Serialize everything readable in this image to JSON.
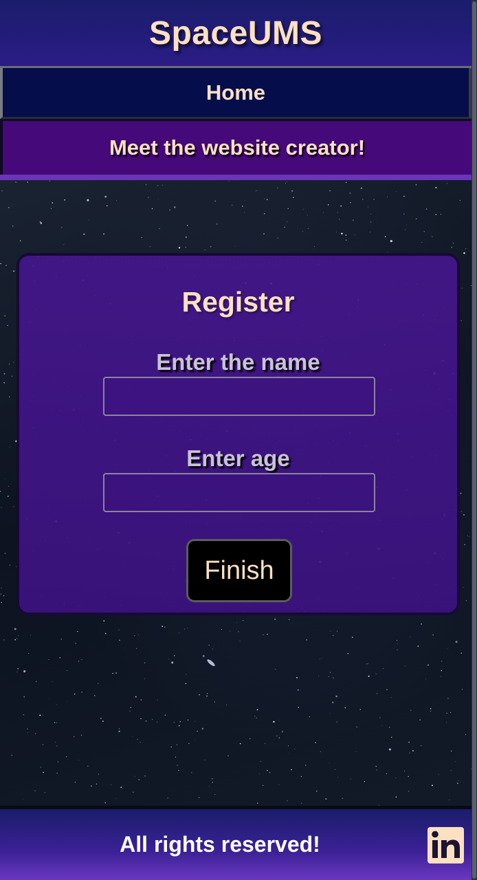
{
  "header": {
    "title": "SpaceUMS"
  },
  "nav": {
    "home_label": "Home",
    "creator_label": "Meet the website creator!"
  },
  "register": {
    "title": "Register",
    "name_label": "Enter the name",
    "name_value": "",
    "age_label": "Enter age",
    "age_value": "",
    "finish_label": "Finish"
  },
  "footer": {
    "text": "All rights reserved!",
    "social_icon": "linkedin-icon"
  },
  "colors": {
    "header_bg": "#2b1c86",
    "nav_home_bg": "#050d4a",
    "nav_creator_bg": "#45097a",
    "card_bg": "#44168c",
    "text_accent": "#fbe0c2",
    "button_bg": "#000000"
  }
}
